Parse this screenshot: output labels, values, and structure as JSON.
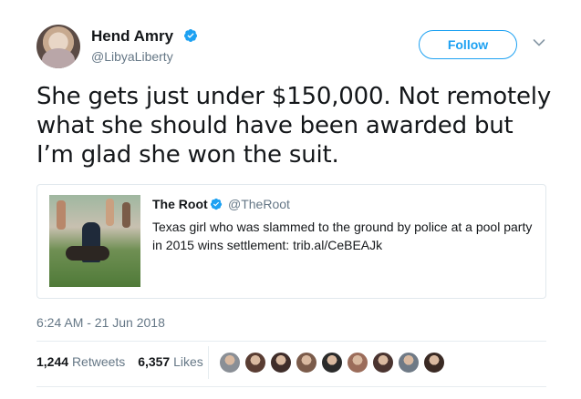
{
  "author": {
    "name": "Hend Amry",
    "handle": "@LibyaLiberty",
    "verified_icon": "verified-badge-icon",
    "avatar_icon": "avatar"
  },
  "actions": {
    "follow_label": "Follow",
    "menu_icon": "chevron-down-icon"
  },
  "tweet": {
    "text": "She gets just under $150,000. Not remotely what she should have been awarded but I’m glad she won the suit.",
    "timestamp": "6:24 AM - 21 Jun 2018"
  },
  "quoted": {
    "name": "The Root",
    "handle": "@TheRoot",
    "text": "Texas girl who was slammed to the ground by police at a pool party in 2015 wins settlement: trib.al/CeBEAJk"
  },
  "stats": {
    "retweets_count": "1,244",
    "retweets_label": "Retweets",
    "likes_count": "6,357",
    "likes_label": "Likes"
  },
  "likers": [
    {
      "color": "#8a8f96"
    },
    {
      "color": "#5a3d33"
    },
    {
      "color": "#3f2d2a"
    },
    {
      "color": "#7b5b4a"
    },
    {
      "color": "#2b2b2b"
    },
    {
      "color": "#9b6c5a"
    },
    {
      "color": "#4a3430"
    },
    {
      "color": "#6f7a86"
    },
    {
      "color": "#3a2a24"
    }
  ],
  "colors": {
    "accent": "#1da1f2",
    "text": "#14171a",
    "secondary": "#657786"
  }
}
